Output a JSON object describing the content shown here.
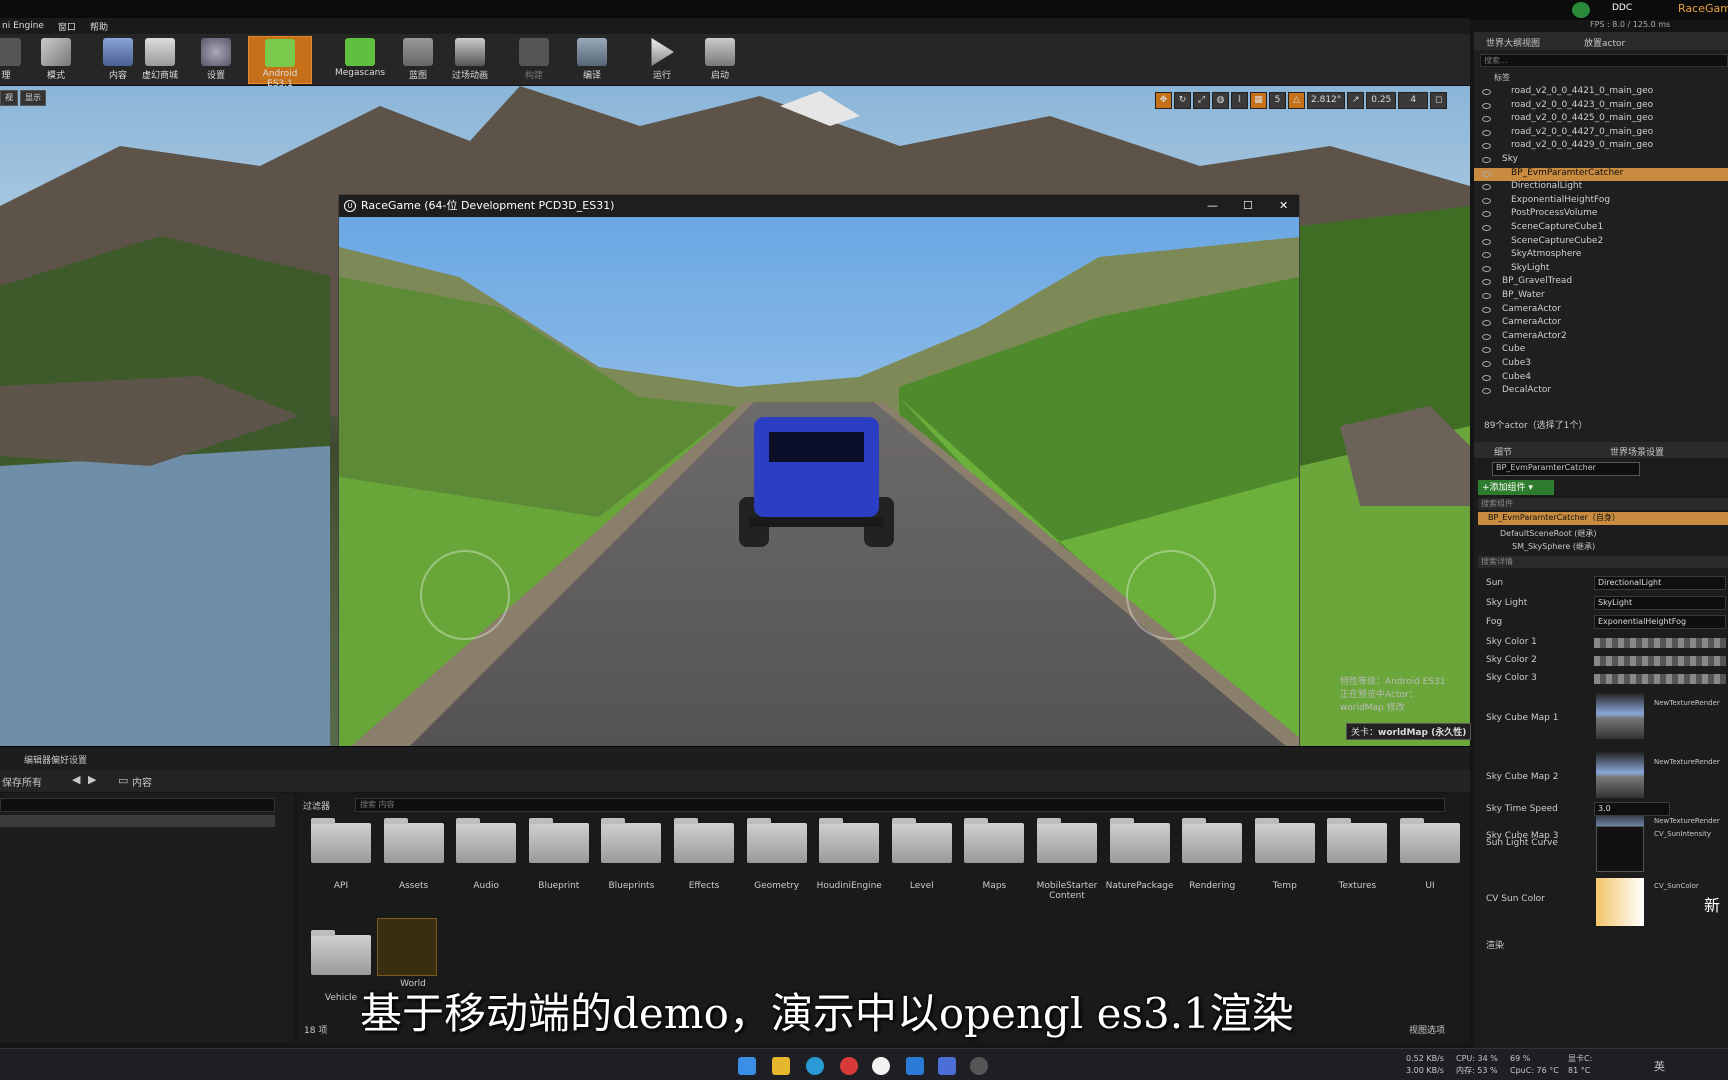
{
  "app": {
    "title_partial": "ni Engine",
    "race_tab": "RaceGame",
    "ddc": "DDC",
    "fps_text": "FPS : 8.0 / 125.0 ms",
    "eye_text": "FPS"
  },
  "menu": [
    "窗口",
    "帮助"
  ],
  "toolbar": {
    "items": [
      {
        "label": "理"
      },
      {
        "label": "模式"
      },
      {
        "label": "内容"
      },
      {
        "label": "虚幻商城"
      },
      {
        "label": "设置"
      },
      {
        "label": "Android ES3.1"
      },
      {
        "label": "Megascans"
      },
      {
        "label": "蓝图"
      },
      {
        "label": "过场动画"
      },
      {
        "label": "构建"
      },
      {
        "label": "编译"
      },
      {
        "label": "运行"
      },
      {
        "label": "启动"
      }
    ]
  },
  "viewport": {
    "left_buttons": [
      "视",
      "显示"
    ],
    "angle": "2.812°",
    "scale": "0.25",
    "grid": "5",
    "cam": "4",
    "overlay_lines": [
      "特性等级：Android ES31",
      "正在预览中Actor：",
      "worldMap 修改"
    ],
    "level_label": "关卡：",
    "level_name": "worldMap (永久性)"
  },
  "game_window": {
    "title": "RaceGame  (64-位 Development PCD3D_ES31)",
    "minimize": "—",
    "maximize": "☐",
    "close": "✕"
  },
  "subtitle": "基于移动端的demo，演示中以opengl es3.1渲染",
  "content_browser": {
    "tab": "编辑器偏好设置",
    "save_all": "保存所有",
    "path": "内容",
    "filter": "过滤器",
    "search_placeholder": "搜索 内容",
    "count": "18 项",
    "view_options": "视图选项",
    "folders": [
      "API",
      "Assets",
      "Audio",
      "Blueprint",
      "Blueprints",
      "Effects",
      "Geometry",
      "HoudiniEngine",
      "Level",
      "Maps",
      "MobileStarter Content",
      "NaturePackage",
      "Rendering",
      "Temp",
      "Textures",
      "UI",
      "Vehicle"
    ],
    "asset": "World"
  },
  "outliner": {
    "tab": "世界大纲视图",
    "tab2": "放置actor",
    "search": "搜索...",
    "header": "标签",
    "rows": [
      {
        "label": "road_v2_0_0_4421_0_main_geo",
        "indent": 3
      },
      {
        "label": "road_v2_0_0_4423_0_main_geo",
        "indent": 3
      },
      {
        "label": "road_v2_0_0_4425_0_main_geo",
        "indent": 3
      },
      {
        "label": "road_v2_0_0_4427_0_main_geo",
        "indent": 3
      },
      {
        "label": "road_v2_0_0_4429_0_main_geo",
        "indent": 3
      },
      {
        "label": "Sky",
        "indent": 2
      },
      {
        "label": "BP_EvmParamterCatcher",
        "indent": 3,
        "selected": true
      },
      {
        "label": "DirectionalLight",
        "indent": 3
      },
      {
        "label": "ExponentialHeightFog",
        "indent": 3
      },
      {
        "label": "PostProcessVolume",
        "indent": 3
      },
      {
        "label": "SceneCaptureCube1",
        "indent": 3
      },
      {
        "label": "SceneCaptureCube2",
        "indent": 3
      },
      {
        "label": "SkyAtmosphere",
        "indent": 3
      },
      {
        "label": "SkyLight",
        "indent": 3
      },
      {
        "label": "BP_GravelTread",
        "indent": 2
      },
      {
        "label": "BP_Water",
        "indent": 2
      },
      {
        "label": "CameraActor",
        "indent": 2
      },
      {
        "label": "CameraActor",
        "indent": 2
      },
      {
        "label": "CameraActor2",
        "indent": 2
      },
      {
        "label": "Cube",
        "indent": 2
      },
      {
        "label": "Cube3",
        "indent": 2
      },
      {
        "label": "Cube4",
        "indent": 2
      },
      {
        "label": "DecalActor",
        "indent": 2
      }
    ],
    "footer": "89个actor（选择了1个）"
  },
  "details": {
    "tab": "细节",
    "tab2": "世界场景设置",
    "name": "BP_EvmParamterCatcher",
    "add_component": "+添加组件 ▾",
    "search_comp": "搜索组件",
    "self": "BP_EvmParamterCatcher（自身）",
    "root": "DefaultSceneRoot (继承)",
    "sphere": "SM_SkySphere (继承)",
    "search_details": "搜索详情",
    "props": [
      {
        "name": "Sun",
        "value": "DirectionalLight"
      },
      {
        "name": "Sky Light",
        "value": "SkyLight"
      },
      {
        "name": "Fog",
        "value": "ExponentialHeightFog"
      }
    ],
    "colors": [
      "Sky Color 1",
      "Sky Color 2",
      "Sky Color 3"
    ],
    "cubemaps": [
      {
        "name": "Sky Cube Map 1",
        "value": "NewTextureRender"
      },
      {
        "name": "Sky Cube Map 2",
        "value": "NewTextureRender"
      },
      {
        "name": "Sky Cube Map 3",
        "value": "NewTextureRender"
      }
    ],
    "time_speed_label": "Sky Time Speed",
    "time_speed": "3.0",
    "curve_label": "Sun Light Curve",
    "curve_value": "CV_SunIntensity",
    "cv_label": "CV Sun Color",
    "cv_value": "CV_SunColor",
    "new_label": "新",
    "misc_label": "渲染"
  },
  "taskbar": {
    "net_up": "0.52 KB/s",
    "net_down": "3.00 KB/s",
    "cpu": "CPU: 34 %",
    "mem": "内存: 53 %",
    "cpu_temp": "CpuC: 76 °C",
    "pct": "69 %",
    "gpu_temp": "81 °C",
    "gpu_label": "显卡C:",
    "ime": "英",
    "brand_color": "#c7701a"
  }
}
